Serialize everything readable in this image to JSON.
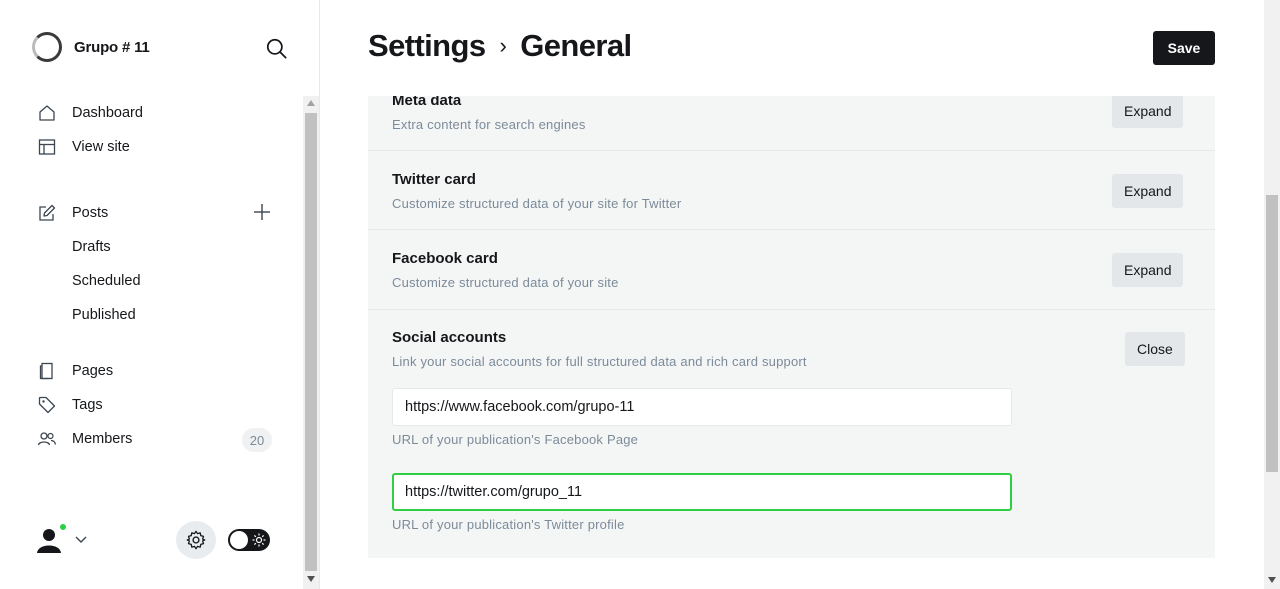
{
  "brand": {
    "name": "Grupo # 11"
  },
  "nav": {
    "dashboard": "Dashboard",
    "view_site": "View site",
    "posts": "Posts",
    "drafts": "Drafts",
    "scheduled": "Scheduled",
    "published": "Published",
    "pages": "Pages",
    "tags": "Tags",
    "members": "Members",
    "members_count": "20"
  },
  "header": {
    "parent": "Settings",
    "separator": "›",
    "current": "General",
    "save_label": "Save"
  },
  "sections": [
    {
      "title": "Meta data",
      "description": "Extra content for search engines",
      "button": "Expand"
    },
    {
      "title": "Twitter card",
      "description": "Customize structured data of your site for Twitter",
      "button": "Expand"
    },
    {
      "title": "Facebook card",
      "description": "Customize structured data of your site",
      "button": "Expand"
    },
    {
      "title": "Social accounts",
      "description": "Link your social accounts for full structured data and rich card support",
      "button": "Close"
    }
  ],
  "social": {
    "facebook_value": "https://www.facebook.com/grupo-11",
    "facebook_hint": "URL of your publication's Facebook Page",
    "twitter_value": "https://twitter.com/grupo_11",
    "twitter_hint": "URL of your publication's Twitter profile"
  },
  "colors": {
    "accent": "#30cf43",
    "dark": "#15171a",
    "muted": "#7c8b9a",
    "section_bg": "#f4f5f5"
  },
  "icons": {
    "search": "search-icon",
    "dashboard": "home-icon",
    "view_site": "layout-icon",
    "posts": "edit-icon",
    "add_post": "plus-icon",
    "pages": "pages-icon",
    "tags": "tag-icon",
    "members": "members-icon",
    "settings": "gear-icon",
    "theme": "sun-icon",
    "user_menu": "chevron-down-icon"
  }
}
